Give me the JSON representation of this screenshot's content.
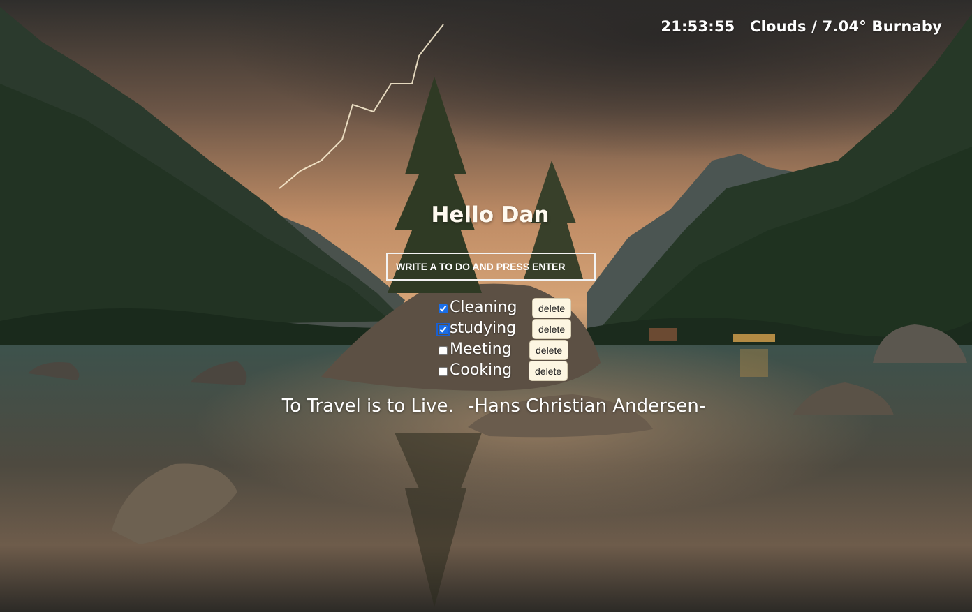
{
  "header": {
    "clock": "21:53:55",
    "weather": "Clouds / 7.04° Burnaby"
  },
  "greeting": "Hello Dan",
  "todo_input": {
    "placeholder": "WRITE A TO DO AND PRESS ENTER",
    "value": ""
  },
  "todos": [
    {
      "text": "Cleaning",
      "checked": true,
      "delete_label": "delete"
    },
    {
      "text": "studying",
      "checked": true,
      "delete_label": "delete"
    },
    {
      "text": "Meeting",
      "checked": false,
      "delete_label": "delete"
    },
    {
      "text": "Cooking",
      "checked": false,
      "delete_label": "delete"
    }
  ],
  "quote": {
    "text": "To Travel is to Live.",
    "author": "-Hans Christian Andersen-"
  },
  "colors": {
    "sky_top": "#3b3732",
    "sky_glow": "#d9a070",
    "mountain": "#27382a",
    "water": "#344a45",
    "checkbox_accent": "#1a6ee8",
    "delete_button_bg": "#fdf6e2"
  }
}
